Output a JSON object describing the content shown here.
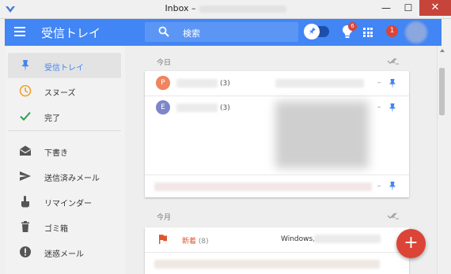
{
  "window": {
    "title": "Inbox –",
    "minimize": "—",
    "maximize": "☐",
    "close": "✕"
  },
  "header": {
    "title": "受信トレイ",
    "search_placeholder": "検索",
    "bulb_badge": "6",
    "notification_badge": "1"
  },
  "sidebar": {
    "items": [
      {
        "label": "受信トレイ",
        "icon": "pin-icon",
        "active": true
      },
      {
        "label": "スヌーズ",
        "icon": "clock-icon"
      },
      {
        "label": "完了",
        "icon": "check-icon"
      },
      {
        "label": "下書き",
        "icon": "drafts-icon"
      },
      {
        "label": "送信済みメール",
        "icon": "send-icon"
      },
      {
        "label": "リマインダー",
        "icon": "reminder-hand-icon"
      },
      {
        "label": "ゴミ箱",
        "icon": "trash-icon"
      },
      {
        "label": "迷惑メール",
        "icon": "spam-icon"
      }
    ]
  },
  "sections": [
    {
      "label": "今日",
      "threads": [
        {
          "avatar": "P",
          "avatar_color": "#f0845f",
          "count": "(3)",
          "dash": "–"
        },
        {
          "avatar": "E",
          "avatar_color": "#7e86c9",
          "count": "(3)",
          "dash": "–"
        },
        {
          "dash": "–"
        }
      ]
    },
    {
      "label": "今月",
      "bundle": {
        "label": "新着",
        "count": "(8)",
        "preview": "Windows,",
        "dash": "–"
      }
    }
  ],
  "colors": {
    "accent": "#4285f4",
    "fab": "#db4437",
    "bundle": "#e0542e"
  },
  "fab": {
    "label": "+"
  }
}
